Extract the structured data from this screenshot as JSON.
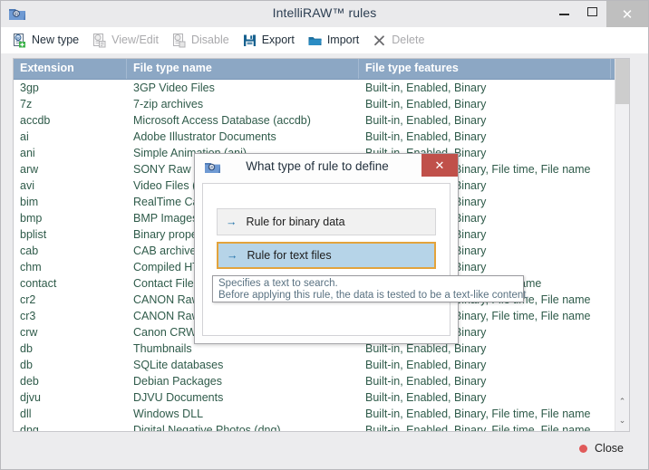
{
  "window": {
    "title": "IntelliRAW™ rules",
    "app_icon": "app-folder-icon",
    "minimize_label": "–",
    "maximize_label": "□",
    "close_label": "✕"
  },
  "toolbar": {
    "items": [
      {
        "label": "New type",
        "icon": "new-type-icon",
        "enabled": true
      },
      {
        "label": "View/Edit",
        "icon": "view-edit-icon",
        "enabled": false
      },
      {
        "label": "Disable",
        "icon": "disable-icon",
        "enabled": false
      },
      {
        "label": "Export",
        "icon": "export-save-icon",
        "enabled": true
      },
      {
        "label": "Import",
        "icon": "import-folder-icon",
        "enabled": true
      },
      {
        "label": "Delete",
        "icon": "delete-x-icon",
        "enabled": false
      }
    ]
  },
  "table": {
    "columns": [
      "Extension",
      "File type name",
      "File type features"
    ],
    "rows": [
      [
        "3gp",
        "3GP Video Files",
        "Built-in, Enabled, Binary"
      ],
      [
        "7z",
        "7-zip archives",
        "Built-in, Enabled, Binary"
      ],
      [
        "accdb",
        "Microsoft Access Database (accdb)",
        "Built-in, Enabled, Binary"
      ],
      [
        "ai",
        "Adobe Illustrator Documents",
        "Built-in, Enabled, Binary"
      ],
      [
        "ani",
        "Simple Animation (ani)",
        "Built-in, Enabled, Binary"
      ],
      [
        "arw",
        "SONY Raw Photos (arw)",
        "Built-in, Enabled, Binary, File time, File name"
      ],
      [
        "avi",
        "Video Files (avi)",
        "Built-in, Enabled, Binary"
      ],
      [
        "bim",
        "RealTime Camera files",
        "Built-in, Enabled, Binary"
      ],
      [
        "bmp",
        "BMP Images",
        "Built-in, Enabled, Binary"
      ],
      [
        "bplist",
        "Binary properties list",
        "Built-in, Enabled, Binary"
      ],
      [
        "cab",
        "CAB archives",
        "Built-in, Enabled, Binary"
      ],
      [
        "chm",
        "Compiled HTML Help",
        "Built-in, Enabled, Binary"
      ],
      [
        "contact",
        "Contact Files",
        "Built-in, Enabled, Binary, File name"
      ],
      [
        "cr2",
        "CANON Raw Photos (cr2)",
        "Built-in, Enabled, Binary, File time, File name"
      ],
      [
        "cr3",
        "CANON Raw Photos (cr3)",
        "Built-in, Enabled, Binary, File time, File name"
      ],
      [
        "crw",
        "Canon CRW files",
        "Built-in, Enabled, Binary"
      ],
      [
        "db",
        "Thumbnails",
        "Built-in, Enabled, Binary"
      ],
      [
        "db",
        "SQLite databases",
        "Built-in, Enabled, Binary"
      ],
      [
        "deb",
        "Debian Packages",
        "Built-in, Enabled, Binary"
      ],
      [
        "djvu",
        "DJVU Documents",
        "Built-in, Enabled, Binary"
      ],
      [
        "dll",
        "Windows DLL",
        "Built-in, Enabled, Binary, File time, File name"
      ],
      [
        "dng",
        "Digital Negative Photos (dng)",
        "Built-in, Enabled, Binary, File time, File name"
      ]
    ]
  },
  "scrollbar": {
    "up_arrow": "⌃",
    "down_arrow": "⌄"
  },
  "footer": {
    "close_label": "Close"
  },
  "dialog": {
    "title": "What type of rule to define",
    "icon": "dialog-app-icon",
    "close_label": "✕",
    "arrow_glyph": "→",
    "options": [
      {
        "label": "Rule for binary data",
        "selected": false
      },
      {
        "label": "Rule for text files",
        "selected": true
      }
    ]
  },
  "tooltip": {
    "line1": "Specifies a text to search.",
    "line2": "Before applying this rule, the data is tested to be a text-like content."
  },
  "colors": {
    "header_blue": "#8ca7c4",
    "row_text_green": "#2f5b4a",
    "selected_fill": "#b6d4e8",
    "selected_border": "#e3a33c",
    "dialog_close_red": "#c0504a",
    "close_dot_red": "#e05a5a"
  }
}
